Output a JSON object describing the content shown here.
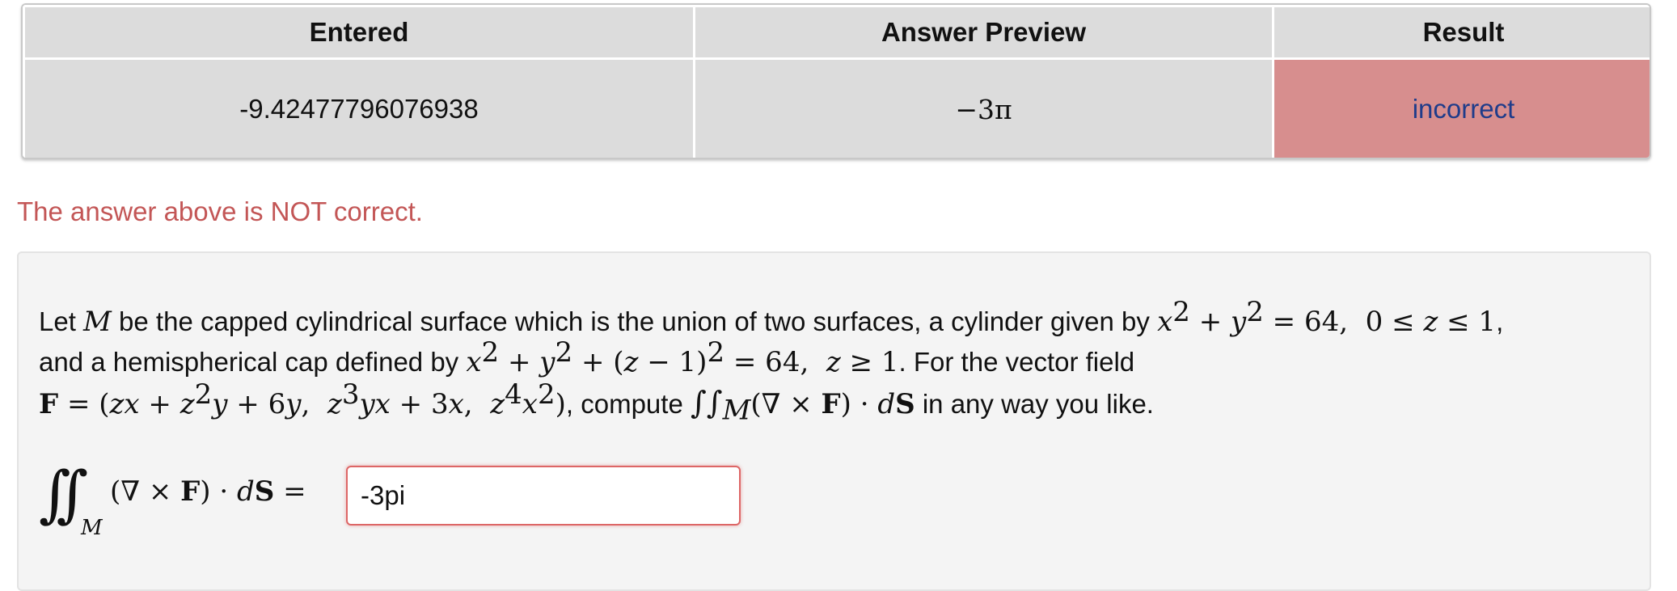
{
  "results_table": {
    "headers": [
      "Entered",
      "Answer Preview",
      "Result"
    ],
    "row": {
      "entered": "-9.42477796076938",
      "preview": "−3π",
      "result": "incorrect"
    }
  },
  "message": "The answer above is NOT correct.",
  "problem": {
    "line1_a": "Let ",
    "line1_M": "M",
    "line1_b": " be the capped cylindrical surface which is the union of two surfaces, a cylinder given by ",
    "line1_c": ", ",
    "line2_a": "and a hemispherical cap defined by ",
    "line2_b": ". For the vector field",
    "line3_compute": ", compute ",
    "line3_tail": " in any way you like."
  },
  "answer": {
    "value": "-3pi"
  },
  "colors": {
    "incorrect_bg": "#d78e8e",
    "incorrect_text": "#1f3c8a",
    "message": "#c35656"
  }
}
